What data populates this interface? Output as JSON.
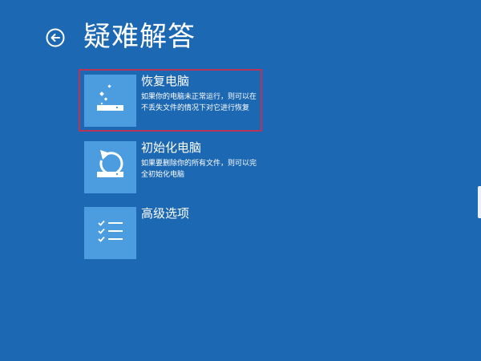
{
  "page": {
    "title": "疑难解答"
  },
  "icons": {
    "back": "back-arrow-circle-icon",
    "refresh": "refresh-pc-sparkle-icon",
    "reset": "reset-pc-cycle-icon",
    "advanced": "checklist-icon"
  },
  "colors": {
    "background": "#1d68b3",
    "tile": "#4c9ddf",
    "selection": "#b8345a",
    "text": "#ffffff"
  },
  "options": [
    {
      "title": "恢复电脑",
      "description": "如果你的电脑未正常运行，则可以在不丢失文件的情况下对它进行恢复",
      "selected": true
    },
    {
      "title": "初始化电脑",
      "description": "如果要删除你的所有文件，则可以完全初始化电脑",
      "selected": false
    },
    {
      "title": "高级选项",
      "description": "",
      "selected": false
    }
  ]
}
